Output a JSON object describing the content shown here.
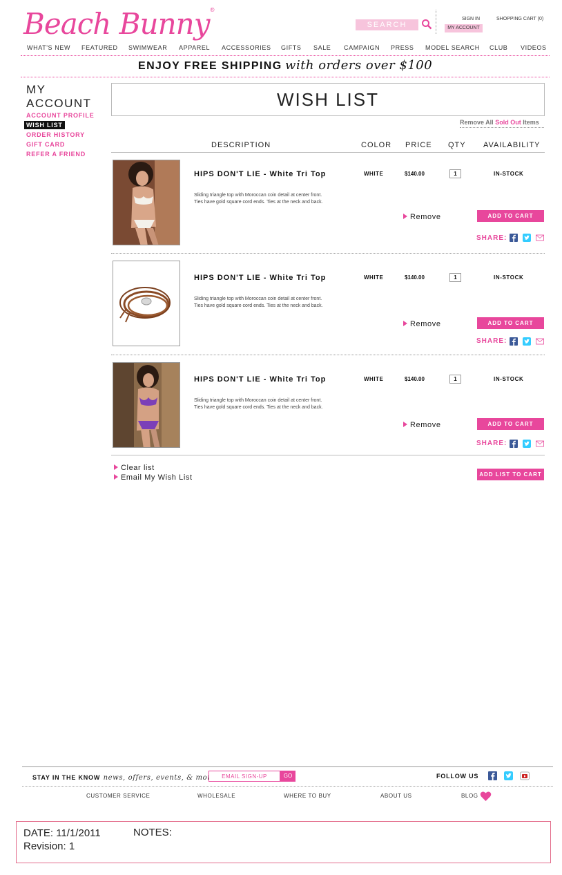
{
  "brand": {
    "name": "Beach Bunny",
    "accent": "#e8479c",
    "accent_light": "#f7c4dc"
  },
  "header": {
    "search_placeholder": "SEARCH",
    "sign_in": "SIGN IN",
    "my_account": "MY ACCOUNT",
    "cart": "SHOPPING CART (0)"
  },
  "nav": [
    "WHAT'S NEW",
    "FEATURED",
    "SWIMWEAR",
    "APPAREL",
    "ACCESSORIES",
    "GIFTS",
    "SALE",
    "CAMPAIGN",
    "PRESS",
    "MODEL SEARCH",
    "CLUB",
    "VIDEOS"
  ],
  "promo": {
    "bold": "ENJOY FREE SHIPPING",
    "script": "with orders over $100"
  },
  "sidebar": {
    "title_line1": "MY",
    "title_line2": "ACCOUNT",
    "items": [
      "ACCOUNT PROFILE",
      "WISH LIST",
      "ORDER HISTORY",
      "GIFT CARD",
      "REFER A FRIEND"
    ],
    "active": "WISH LIST"
  },
  "page_title": "WISH LIST",
  "remove_all": {
    "prefix": "Remove All",
    "highlight": "Sold Out",
    "suffix": "Items"
  },
  "columns": {
    "description": "DESCRIPTION",
    "color": "COLOR",
    "price": "PRICE",
    "qty": "QTY",
    "availability": "AVAILABILITY"
  },
  "items": [
    {
      "name": "HIPS DON'T LIE  - White Tri Top",
      "desc_line1": "Sliding triangle top with Moroccan coin detail at center front.",
      "desc_line2": "Ties have gold square cord ends. Ties at the neck and back.",
      "color": "WHITE",
      "price": "$140.00",
      "qty": "1",
      "availability": "IN-STOCK",
      "remove": "Remove",
      "add_to_cart": "ADD TO CART",
      "share": "SHARE:"
    },
    {
      "name": "HIPS DON'T LIE  - White Tri Top",
      "desc_line1": "Sliding triangle top with Moroccan coin detail at center front.",
      "desc_line2": "Ties have gold square cord ends. Ties at the neck and back.",
      "color": "WHITE",
      "price": "$140.00",
      "qty": "1",
      "availability": "IN-STOCK",
      "remove": "Remove",
      "add_to_cart": "ADD TO CART",
      "share": "SHARE:"
    },
    {
      "name": "HIPS DON'T LIE  - White Tri Top",
      "desc_line1": "Sliding triangle top with Moroccan coin detail at center front.",
      "desc_line2": "Ties have gold square cord ends. Ties at the neck and back.",
      "color": "WHITE",
      "price": "$140.00",
      "qty": "1",
      "availability": "IN-STOCK",
      "remove": "Remove",
      "add_to_cart": "ADD TO CART",
      "share": "SHARE:"
    }
  ],
  "list_actions": {
    "clear": "Clear list",
    "email": "Email My Wish List",
    "add_list": "ADD LIST TO CART"
  },
  "footer": {
    "stay_bold": "STAY IN THE KNOW",
    "stay_script": "news, offers, events, & more",
    "email_placeholder": "EMAIL SIGN-UP",
    "go": "GO",
    "follow": "FOLLOW US",
    "links": [
      "CUSTOMER SERVICE",
      "WHOLESALE",
      "WHERE TO BUY",
      "ABOUT US",
      "BLOG"
    ]
  },
  "notes": {
    "date": "DATE: 11/1/2011",
    "revision": "Revision: 1",
    "notes_label": "NOTES:"
  }
}
